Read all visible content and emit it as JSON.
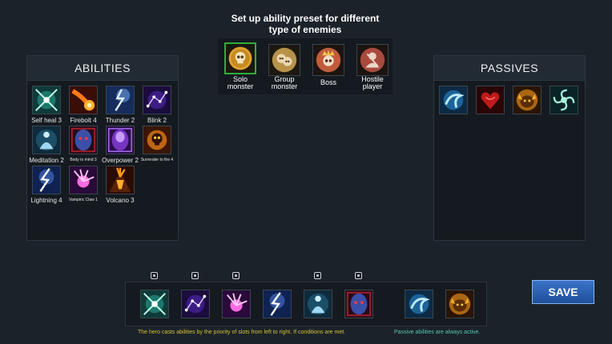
{
  "preset": {
    "title_line1": "Set up ability preset for different",
    "title_line2": "type of enemies",
    "options": [
      {
        "label_line1": "Solo",
        "label_line2": "monster",
        "icon": "skull-icon",
        "selected": true
      },
      {
        "label_line1": "Group",
        "label_line2": "monster",
        "icon": "group-skulls-icon",
        "selected": false
      },
      {
        "label_line1": "Boss",
        "label_line2": "",
        "icon": "boss-skull-icon",
        "selected": false
      },
      {
        "label_line1": "Hostile",
        "label_line2": "player",
        "icon": "hostile-player-icon",
        "selected": false
      }
    ]
  },
  "abilities": {
    "title": "ABILITIES",
    "items": [
      {
        "label": "Self heal 3",
        "icon": "self-heal-icon"
      },
      {
        "label": "Firebolt 4",
        "icon": "firebolt-icon"
      },
      {
        "label": "Thunder 2",
        "icon": "thunder-icon"
      },
      {
        "label": "Blink 2",
        "icon": "blink-icon"
      },
      {
        "label": "Meditation 2",
        "icon": "meditation-icon"
      },
      {
        "label": "Body to mind 3",
        "icon": "body-to-mind-icon"
      },
      {
        "label": "Overpower 2",
        "icon": "overpower-icon"
      },
      {
        "label": "Surrender to fire 4",
        "icon": "surrender-to-fire-icon"
      },
      {
        "label": "Lightning 4",
        "icon": "lightning-icon"
      },
      {
        "label": "Vampiric Claw 1",
        "icon": "vampiric-claw-icon"
      },
      {
        "label": "Volcano 3",
        "icon": "volcano-icon"
      }
    ]
  },
  "passives": {
    "title": "PASSIVES",
    "items": [
      {
        "icon": "water-swirl-icon"
      },
      {
        "icon": "heart-icon"
      },
      {
        "icon": "golden-beast-icon"
      },
      {
        "icon": "whirlwind-icon"
      }
    ]
  },
  "slots": {
    "active": [
      {
        "icon": "self-heal-icon",
        "has_settings": true
      },
      {
        "icon": "blink-icon",
        "has_settings": true
      },
      {
        "icon": "vampiric-claw-icon",
        "has_settings": true
      },
      {
        "icon": "lightning-icon",
        "has_settings": false
      },
      {
        "icon": "meditation-icon",
        "has_settings": true
      },
      {
        "icon": "body-to-mind-icon",
        "has_settings": true
      }
    ],
    "passive": [
      {
        "icon": "water-swirl-icon"
      },
      {
        "icon": "golden-beast-icon"
      }
    ]
  },
  "save_label": "SAVE",
  "notes": {
    "active": "The hero casts abilities by the priority of slots from left to right. If conditions are met.",
    "passive": "Passive abilities are always active."
  },
  "colors": {
    "active_note": "#d4c23a",
    "passive_note": "#56c9b0",
    "selected_border": "#2fae3a",
    "save_button": "#2a5fb0"
  }
}
